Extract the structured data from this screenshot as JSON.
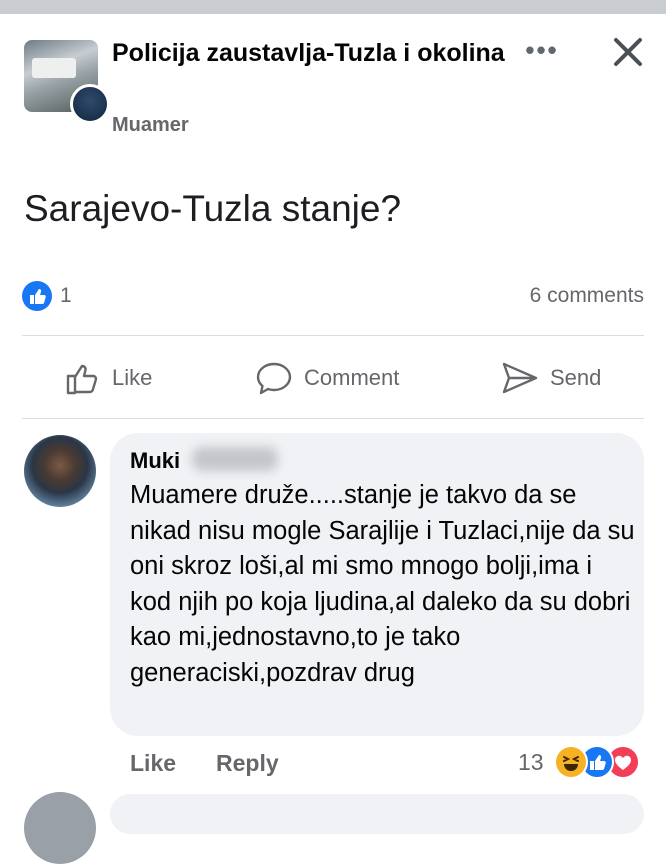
{
  "post": {
    "group_name": "Policija zaustavlja-Tuzla i okolina",
    "author_name": "Muamer",
    "more_icon": "more-horizontal-icon",
    "more_label": "•••",
    "close_icon": "close-icon",
    "text": "Sarajevo-Tuzla stanje?",
    "reactions": {
      "like_count": "1",
      "comments": "6 comments"
    },
    "actions": {
      "like": "Like",
      "comment": "Comment",
      "send": "Send"
    }
  },
  "comment": {
    "author": "Muki",
    "text": "Muamere druže.....stanje je takvo da se nikad nisu mogle Sarajlije i Tuzlaci,nije da su oni skroz loši,al mi smo mnogo bolji,ima i kod njih po koja ljudina,al daleko da su dobri kao mi,jednostavno,to je tako generaciski,pozdrav drug",
    "like_label": "Like",
    "reply_label": "Reply",
    "reaction_count": "13",
    "reaction_icons": [
      "haha-icon",
      "like-icon",
      "love-icon"
    ]
  },
  "colors": {
    "accent": "#1877f2",
    "secondary_text": "#65676b",
    "bubble": "#f0f2f5",
    "love": "#f33e58",
    "haha": "#f7b125"
  }
}
